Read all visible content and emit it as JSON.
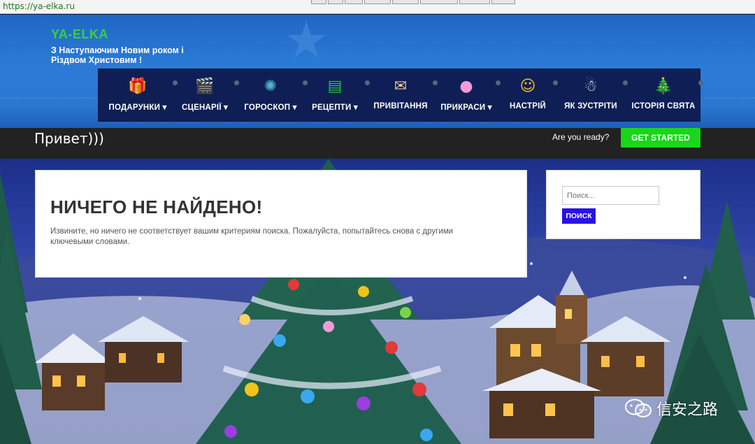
{
  "browser": {
    "url": "https://ya-elka.ru"
  },
  "header": {
    "site_title": "YA-ELKA",
    "tagline": "З Наступаючим Новим роком і Різдвом Христовим !",
    "colors": {
      "title": "#3bd03b",
      "header_bg": "#2b7bd6",
      "nav_bg": "#0f1f55"
    }
  },
  "nav": {
    "items": [
      {
        "label": "ПОДАРУНКИ ▾",
        "icon": "gift-icon",
        "glyph": "🎁"
      },
      {
        "label": "СЦЕНАРІЇ ▾",
        "icon": "clapperboard-icon",
        "glyph": "🎬"
      },
      {
        "label": "ГОРОСКОП ▾",
        "icon": "zodiac-wheel-icon",
        "glyph": "✺"
      },
      {
        "label": "РЕЦЕПТИ ▾",
        "icon": "recipe-book-icon",
        "glyph": "▤"
      },
      {
        "label": "ПРИВІТАННЯ",
        "icon": "envelope-icon",
        "glyph": "✉"
      },
      {
        "label": "ПРИКРАСИ ▾",
        "icon": "ornament-bulb-icon",
        "glyph": "●"
      },
      {
        "label": "НАСТРІЙ",
        "icon": "smiley-icon",
        "glyph": "☺"
      },
      {
        "label": "ЯК ЗУСТРІТИ",
        "icon": "snowman-icon",
        "glyph": "☃"
      },
      {
        "label": "ІСТОРІЯ СВЯТА",
        "icon": "christmas-tree-icon",
        "glyph": "🎄"
      }
    ]
  },
  "strip": {
    "title": "Привет)))",
    "ready_text": "Are you ready?",
    "button_label": "GET STARTED",
    "button_color": "#19d619"
  },
  "main": {
    "heading": "НИЧЕГО НЕ НАЙДЕНО!",
    "message": "Извините, но ничего не соответствует вашим критериям поиска. Пожалуйста, попытайтесь снова с другими ключевыми словами."
  },
  "sidebar": {
    "search_placeholder": "Поиск...",
    "search_button": "ПОИСК",
    "button_color": "#2a10e6"
  },
  "watermark": {
    "text": "信安之路",
    "icon": "wechat-icon"
  }
}
